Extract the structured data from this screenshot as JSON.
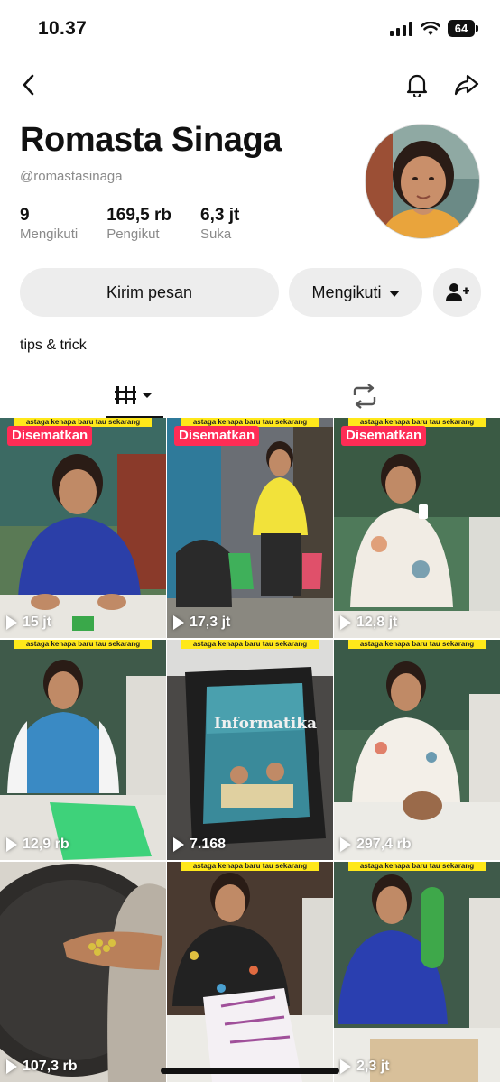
{
  "status_bar": {
    "time": "10.37",
    "battery": "64",
    "icons": [
      "signal-icon",
      "wifi-icon",
      "battery-icon"
    ]
  },
  "nav": {
    "icons": [
      "back-icon",
      "bell-icon",
      "share-icon"
    ]
  },
  "profile": {
    "name": "Romasta Sinaga",
    "handle": "@romastasinaga",
    "stats": [
      {
        "value": "9",
        "label": "Mengikuti"
      },
      {
        "value": "169,5 rb",
        "label": "Pengikut"
      },
      {
        "value": "6,3 jt",
        "label": "Suka"
      }
    ],
    "bio": "tips & trick"
  },
  "actions": {
    "message": "Kirim pesan",
    "following": "Mengikuti"
  },
  "tabs": [
    {
      "icon": "videos-grid-icon",
      "selected": true
    },
    {
      "icon": "repost-icon",
      "selected": false
    }
  ],
  "videos": [
    {
      "caption": "astaga kenapa baru tau sekarang",
      "badge": "Disematkan",
      "views": "15 jt"
    },
    {
      "caption": "astaga kenapa baru tau sekarang",
      "badge": "Disematkan",
      "views": "17,3 jt"
    },
    {
      "caption": "astaga kenapa baru tau sekarang",
      "badge": "Disematkan",
      "views": "12,8 jt"
    },
    {
      "caption": "astaga kenapa baru tau sekarang",
      "badge": "",
      "views": "12,9 rb"
    },
    {
      "caption": "astaga kenapa baru tau sekarang",
      "badge": "",
      "views": "7.168",
      "book_title": "Informatika"
    },
    {
      "caption": "astaga kenapa baru tau sekarang",
      "badge": "",
      "views": "297,4 rb"
    },
    {
      "caption": "",
      "badge": "",
      "views": "107,3 rb"
    },
    {
      "caption": "astaga kenapa baru tau sekarang",
      "badge": "",
      "views": ""
    },
    {
      "caption": "astaga kenapa baru tau sekarang",
      "badge": "",
      "views": "2,3 jt"
    }
  ],
  "colors": {
    "accent": "#fe2c55",
    "button_bg": "#ededed",
    "caption_bar": "#ffe81a"
  }
}
